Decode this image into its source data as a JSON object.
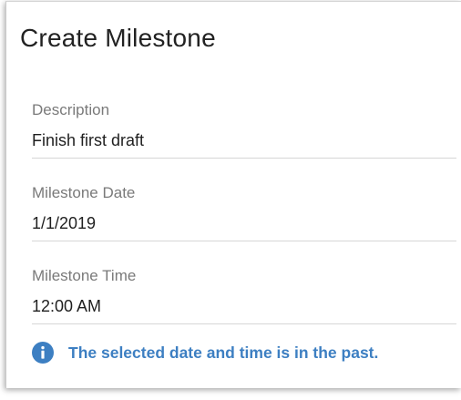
{
  "dialog": {
    "title": "Create Milestone"
  },
  "fields": {
    "description": {
      "label": "Description",
      "value": "Finish first draft"
    },
    "date": {
      "label": "Milestone Date",
      "value": "1/1/2019"
    },
    "time": {
      "label": "Milestone Time",
      "value": "12:00 AM"
    }
  },
  "notice": {
    "icon": "info-icon",
    "text": "The selected date and time is in the past.",
    "color": "#3d7fc2"
  },
  "colors": {
    "label": "#7a7a7a",
    "value": "#1f1f1f",
    "divider": "#d6d6d6"
  }
}
